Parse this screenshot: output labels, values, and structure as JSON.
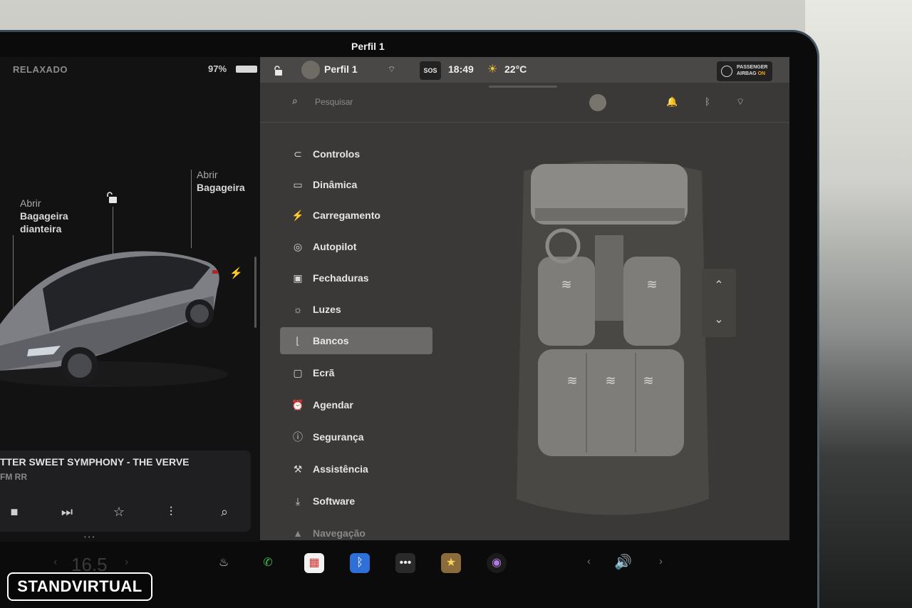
{
  "left_panel": {
    "drive_mode": "RELAXADO",
    "battery": "97%",
    "frunk_callout": {
      "action": "Abrir",
      "target_line1": "Bagageira",
      "target_line2": "dianteira"
    },
    "trunk_callout": {
      "action": "Abrir",
      "target": "Bagageira"
    },
    "now_playing": {
      "title": "TTER SWEET SYMPHONY - THE VERVE",
      "source": "FM RR"
    },
    "cabin_temp": "16.5"
  },
  "status_bar": {
    "profile": "Perfil 1",
    "sos": "SOS",
    "time": "18:49",
    "outside_temp": "22°C",
    "airbag_line1": "PASSENGER",
    "airbag_line2": "AIRBAG",
    "airbag_state": "ON"
  },
  "settings": {
    "search_placeholder": "Pesquisar",
    "profile": "Perfil 1",
    "menu": [
      {
        "label": "Controlos",
        "icon": "toggle-icon"
      },
      {
        "label": "Dinâmica",
        "icon": "car-icon"
      },
      {
        "label": "Carregamento",
        "icon": "bolt-icon"
      },
      {
        "label": "Autopilot",
        "icon": "steering-wheel-icon"
      },
      {
        "label": "Fechaduras",
        "icon": "lock-icon"
      },
      {
        "label": "Luzes",
        "icon": "sun-icon"
      },
      {
        "label": "Bancos",
        "icon": "seat-icon"
      },
      {
        "label": "Ecrã",
        "icon": "display-icon"
      },
      {
        "label": "Agendar",
        "icon": "alarm-icon"
      },
      {
        "label": "Segurança",
        "icon": "alert-icon"
      },
      {
        "label": "Assistência",
        "icon": "wrench-icon"
      },
      {
        "label": "Software",
        "icon": "download-icon"
      },
      {
        "label": "Navegação",
        "icon": "navigation-icon"
      }
    ],
    "active_item": "Bancos"
  },
  "watermark": "STANDVIRTUAL"
}
